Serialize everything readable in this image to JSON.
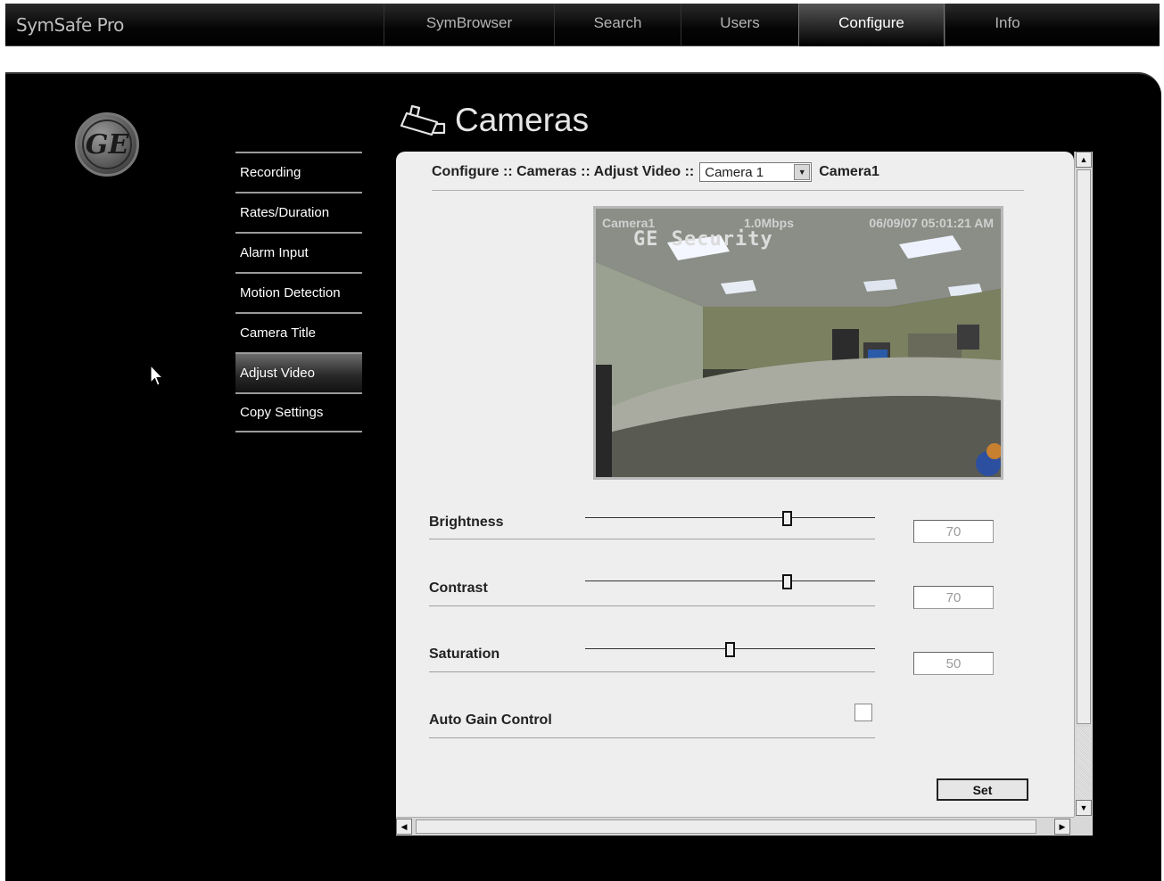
{
  "app": {
    "title": "SymSafe Pro"
  },
  "nav": {
    "tabs": [
      {
        "label": "SymBrowser",
        "active": false
      },
      {
        "label": "Search",
        "active": false
      },
      {
        "label": "Users",
        "active": false
      },
      {
        "label": "Configure",
        "active": true
      },
      {
        "label": "Info",
        "active": false
      }
    ]
  },
  "logo": {
    "text": "GE"
  },
  "side_menu": {
    "items": [
      {
        "label": "Recording",
        "active": false
      },
      {
        "label": "Rates/Duration",
        "active": false
      },
      {
        "label": "Alarm Input",
        "active": false
      },
      {
        "label": "Motion Detection",
        "active": false
      },
      {
        "label": "Camera Title",
        "active": false
      },
      {
        "label": "Adjust Video",
        "active": true
      },
      {
        "label": "Copy Settings",
        "active": false
      }
    ]
  },
  "page": {
    "title": "Cameras",
    "icon": "camera-icon"
  },
  "breadcrumb": {
    "path": "Configure :: Cameras :: Adjust Video ::",
    "camera_select_value": "Camera 1",
    "camera_name": "Camera1"
  },
  "video": {
    "osd_camera": "Camera1",
    "osd_bitrate": "1.0Mbps",
    "osd_timestamp": "06/09/07 05:01:21 AM",
    "osd_brand": "GE Security"
  },
  "controls": {
    "brightness": {
      "label": "Brightness",
      "value": "70",
      "fraction": 0.7
    },
    "contrast": {
      "label": "Contrast",
      "value": "70",
      "fraction": 0.7
    },
    "saturation": {
      "label": "Saturation",
      "value": "50",
      "fraction": 0.5
    },
    "auto_gain": {
      "label": "Auto Gain Control",
      "checked": false
    }
  },
  "buttons": {
    "set_label": "Set"
  },
  "colors": {
    "topbar": "#000000",
    "panel_bg": "#000000",
    "content_bg": "#eeeeee",
    "text_light": "#ffffff"
  }
}
